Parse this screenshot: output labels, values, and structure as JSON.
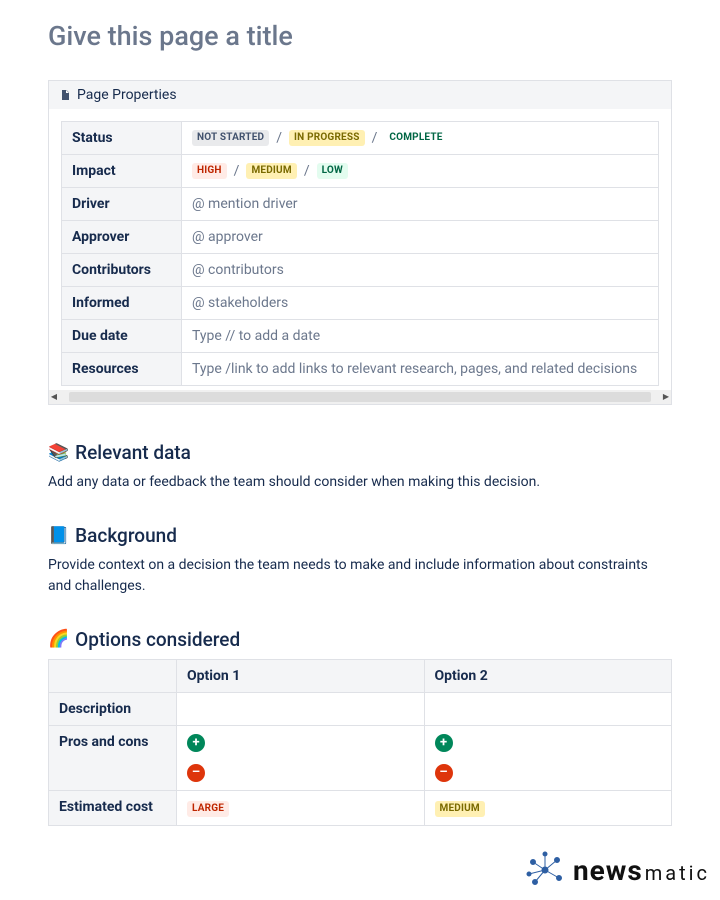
{
  "page": {
    "title_placeholder": "Give this page a title",
    "panel_label": "Page Properties"
  },
  "properties": {
    "rows": [
      {
        "label": "Status"
      },
      {
        "label": "Impact"
      },
      {
        "label": "Driver",
        "placeholder": "@ mention driver"
      },
      {
        "label": "Approver",
        "placeholder": "@ approver"
      },
      {
        "label": "Contributors",
        "placeholder": "@ contributors"
      },
      {
        "label": "Informed",
        "placeholder": "@ stakeholders"
      },
      {
        "label": "Due date",
        "placeholder": "Type // to add a date"
      },
      {
        "label": "Resources",
        "placeholder": "Type /link to add links to relevant research, pages, and related decisions"
      }
    ],
    "status_pills": [
      "NOT STARTED",
      "IN PROGRESS",
      "COMPLETE"
    ],
    "impact_pills": [
      "HIGH",
      "MEDIUM",
      "LOW"
    ],
    "separator": "/"
  },
  "sections": {
    "relevant_data": {
      "emoji": "📚",
      "title": "Relevant data",
      "text": "Add any data or feedback the team should consider when making this decision."
    },
    "background": {
      "emoji": "📘",
      "title": "Background",
      "text": "Provide context on a decision the team needs to make and include information about constraints and challenges."
    },
    "options": {
      "emoji": "🌈",
      "title": "Options considered"
    }
  },
  "options_table": {
    "columns": [
      "",
      "Option 1",
      "Option 2"
    ],
    "rows": {
      "description": "Description",
      "pros_cons": "Pros and cons",
      "estimated_cost": "Estimated cost"
    },
    "cost_pills": {
      "opt1": "LARGE",
      "opt2": "MEDIUM"
    }
  },
  "watermark": {
    "a": "news",
    "b": "matic"
  }
}
